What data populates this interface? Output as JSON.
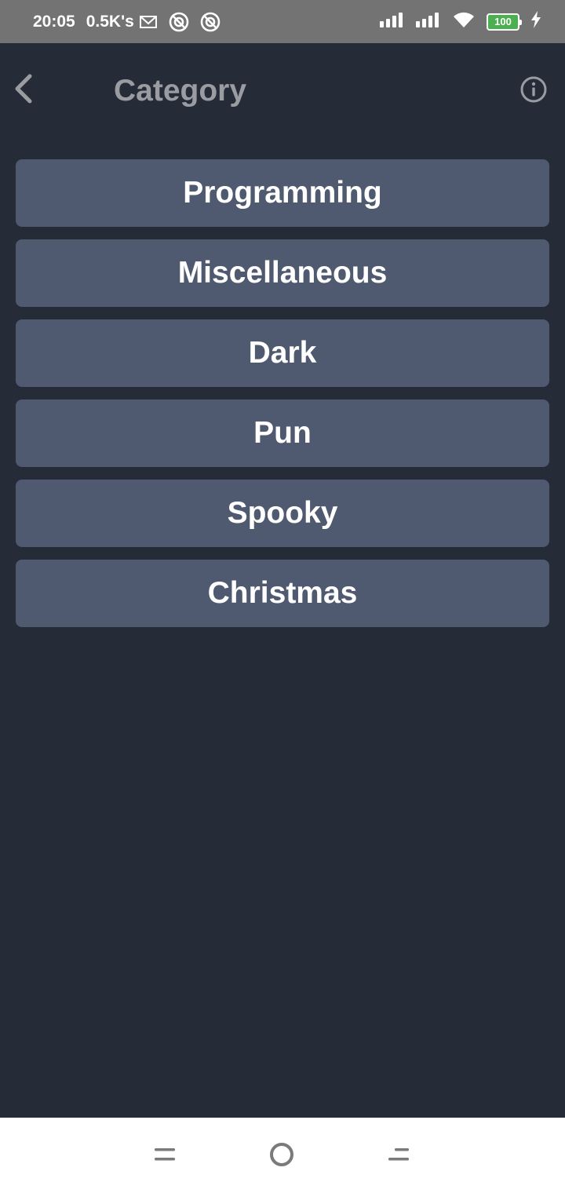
{
  "status_bar": {
    "time": "20:05",
    "net_speed": "0.5K's",
    "battery_level": "100",
    "icons": [
      "gmail-icon",
      "notification-icon",
      "notification-icon",
      "signal-icon",
      "signal-icon",
      "wifi-icon",
      "battery-icon",
      "charging-icon"
    ]
  },
  "app_bar": {
    "title": "Category",
    "back_icon": "chevron-left-icon",
    "info_icon": "info-icon"
  },
  "categories": [
    {
      "label": "Programming"
    },
    {
      "label": "Miscellaneous"
    },
    {
      "label": "Dark"
    },
    {
      "label": "Pun"
    },
    {
      "label": "Spooky"
    },
    {
      "label": "Christmas"
    }
  ],
  "nav_bar": {
    "icons": [
      "menu-icon",
      "home-icon",
      "back-icon"
    ]
  },
  "colors": {
    "background": "#262b38",
    "button": "#4f596f",
    "status_bar": "#737373",
    "title": "#9a9ca2",
    "battery": "#4caf50"
  }
}
